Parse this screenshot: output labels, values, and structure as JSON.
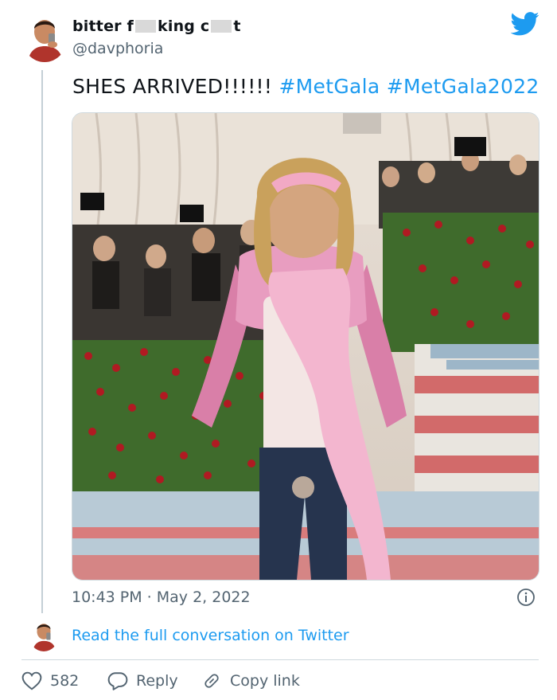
{
  "user": {
    "name_parts": [
      "bitter f",
      "king c",
      "t"
    ],
    "handle": "@davphoria"
  },
  "tweet": {
    "text": "SHES ARRIVED!!!!!! ",
    "hashtags": [
      "#MetGala",
      "#MetGala2022"
    ],
    "timestamp": "10:43 PM · May 2, 2022"
  },
  "links": {
    "read_conversation": "Read the full conversation on Twitter"
  },
  "actions": {
    "like_count": "582",
    "reply_label": "Reply",
    "copy_label": "Copy link"
  },
  "icons": {
    "brand": "twitter-bird-icon",
    "info": "info-icon",
    "like": "heart-icon",
    "reply": "speech-bubble-icon",
    "copy": "chain-link-icon"
  },
  "colors": {
    "accent": "#1d9bf0",
    "text": "#0f1419",
    "muted": "#536471",
    "border": "#cfd9de"
  }
}
